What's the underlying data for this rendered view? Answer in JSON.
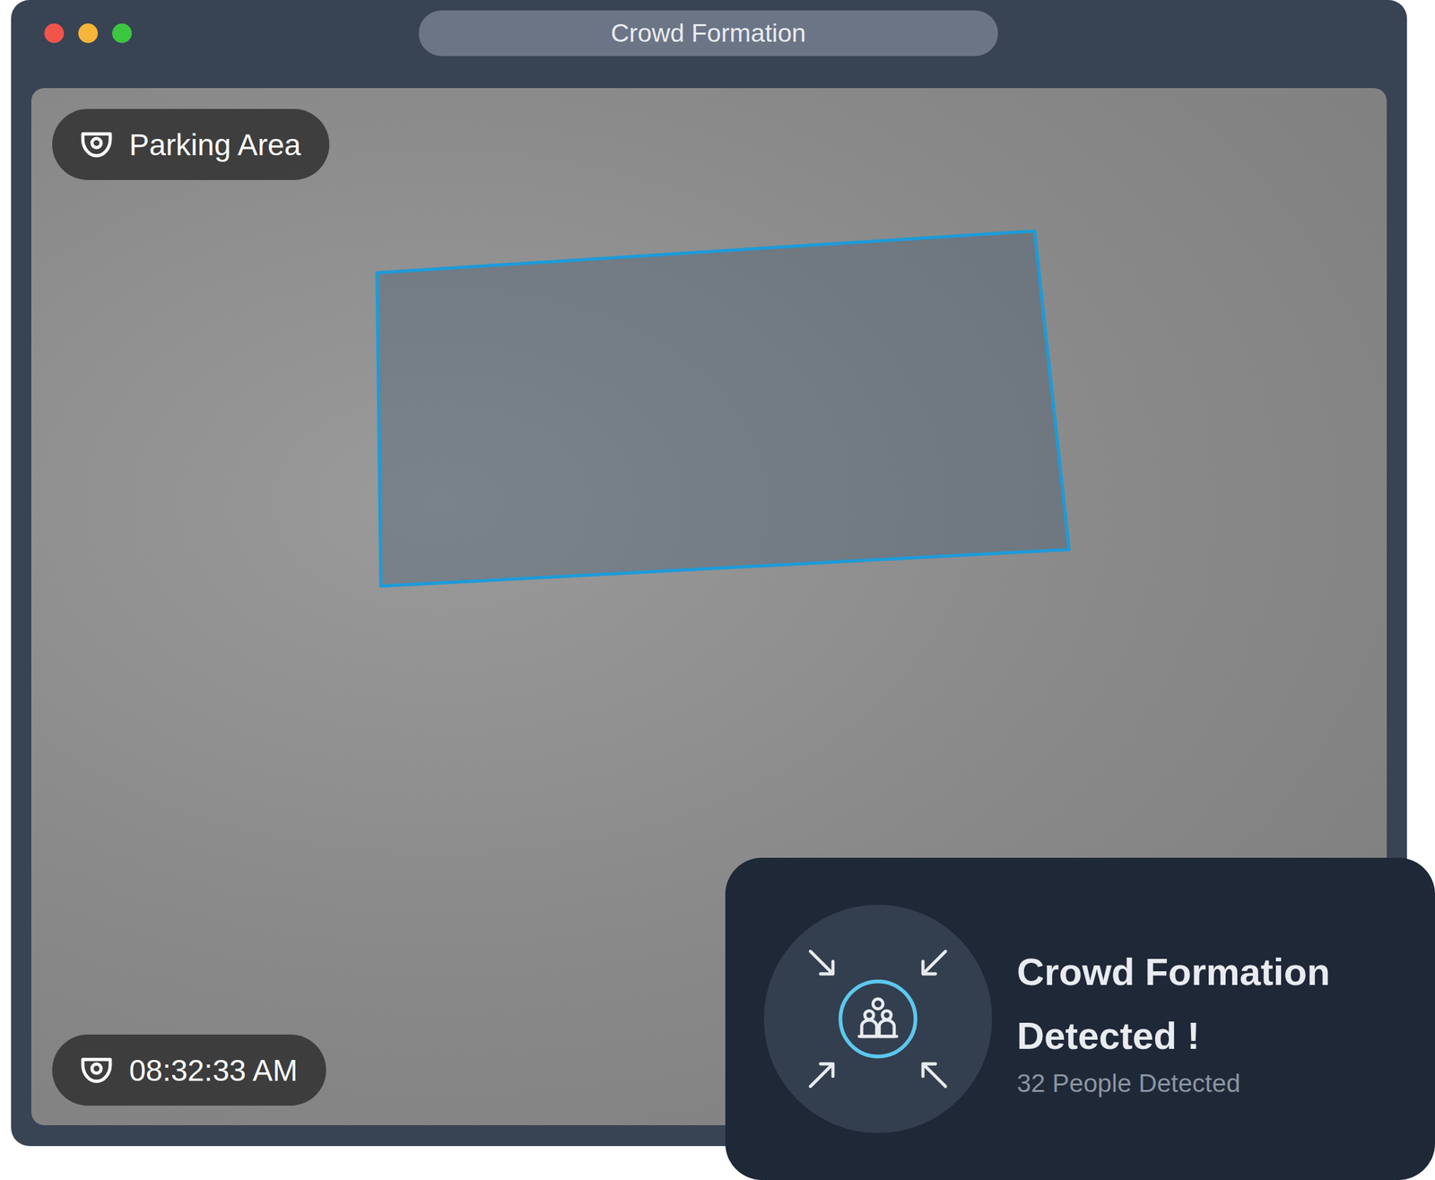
{
  "window": {
    "title": "Crowd Formation"
  },
  "camera": {
    "location": "Parking Area",
    "time": "08:32:33 AM"
  },
  "detection_box": {
    "shown": true
  },
  "alert": {
    "title": "Crowd Formation Detected !",
    "count": "32 People Detected"
  }
}
